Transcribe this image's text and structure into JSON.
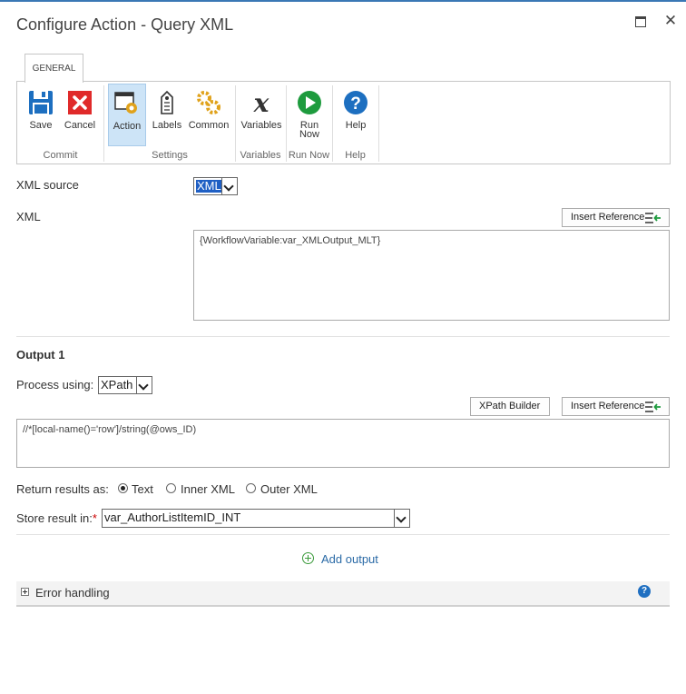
{
  "window": {
    "title": "Configure Action - Query XML"
  },
  "ribbon": {
    "tab": "GENERAL",
    "buttons": {
      "save": "Save",
      "cancel": "Cancel",
      "action": "Action",
      "labels": "Labels",
      "common": "Common",
      "variables": "Variables",
      "run_now": "Run Now",
      "help": "Help"
    },
    "groups": {
      "commit": "Commit",
      "settings": "Settings",
      "variables": "Variables",
      "run_now": "Run Now",
      "help": "Help"
    }
  },
  "form": {
    "xml_source_label": "XML source",
    "xml_source_value": "XML",
    "xml_label": "XML",
    "insert_reference": "Insert Reference",
    "xml_value": "{WorkflowVariable:var_XMLOutput_MLT}",
    "output_heading": "Output 1",
    "process_using_label": "Process using:",
    "process_using_value": "XPath",
    "xpath_builder": "XPath Builder",
    "xpath_value": "//*[local-name()='row']/string(@ows_ID)",
    "return_results_label": "Return results as:",
    "return_options": [
      "Text",
      "Inner XML",
      "Outer XML"
    ],
    "store_result_label": "Store result in:",
    "required_marker": "*",
    "store_result_value": "var_AuthorListItemID_INT",
    "add_output": "Add output",
    "error_handling": "Error handling",
    "help_glyph": "?"
  },
  "colors": {
    "accent": "#3a78b5",
    "link": "#2a6aa6",
    "selection": "#1f5fc4"
  }
}
